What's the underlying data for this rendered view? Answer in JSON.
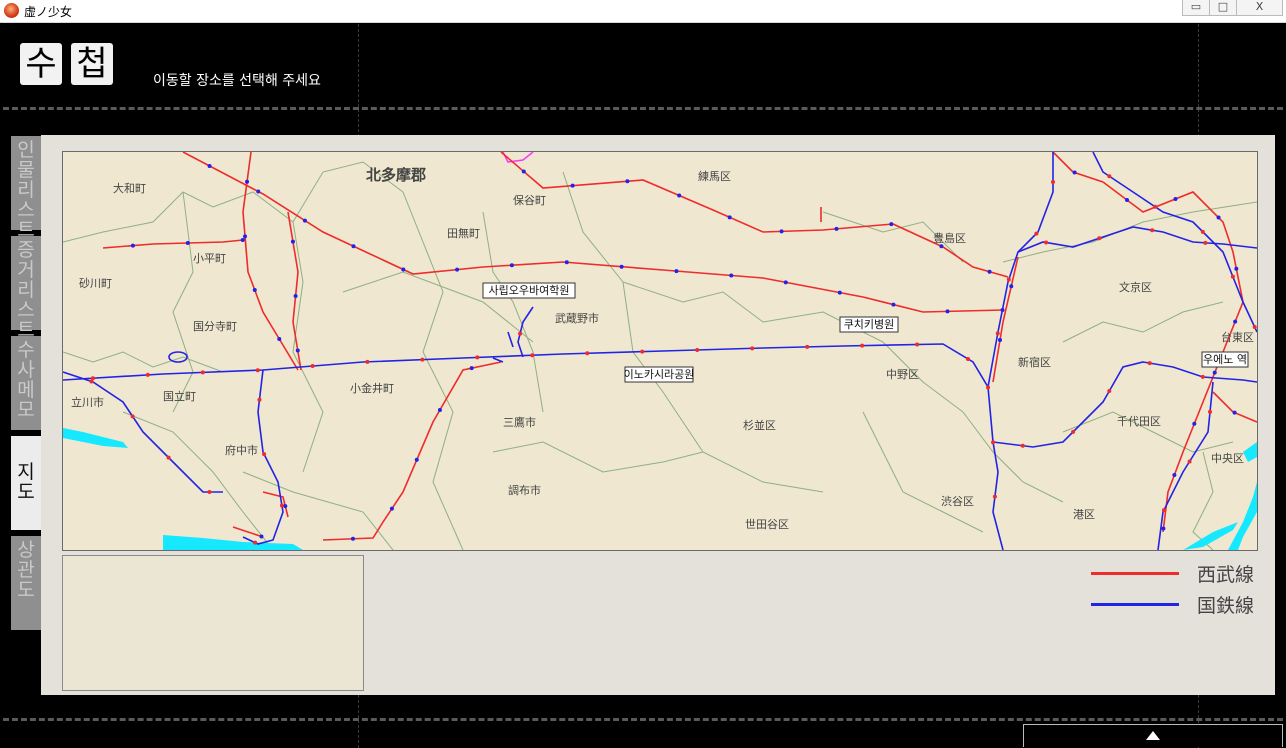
{
  "window": {
    "title": "虚ノ少女",
    "minimize_glyph": "▭",
    "maximize_glyph": "□",
    "close_glyph": "X"
  },
  "header": {
    "logo_chars": [
      "수",
      "첩"
    ],
    "instruction": "이동할 장소를 선택해 주세요"
  },
  "tabs": [
    {
      "label": "인물리스트",
      "active": false
    },
    {
      "label": "증거리스트",
      "active": false
    },
    {
      "label": "수사메모",
      "active": false
    },
    {
      "label": "지도",
      "active": true
    },
    {
      "label": "상관도",
      "active": false
    }
  ],
  "map": {
    "colors": {
      "background": "#efe7d0",
      "boundary": "#8fb083",
      "water": "#16e8ff",
      "seibu": "#ef2b2b",
      "jr": "#2323e6"
    },
    "district_labels": [
      {
        "text": "北多摩郡"
      },
      {
        "text": "大和町"
      },
      {
        "text": "小平町"
      },
      {
        "text": "砂川町"
      },
      {
        "text": "国分寺町"
      },
      {
        "text": "立川市"
      },
      {
        "text": "国立町"
      },
      {
        "text": "府中市"
      },
      {
        "text": "小金井町"
      },
      {
        "text": "保谷町"
      },
      {
        "text": "田無町"
      },
      {
        "text": "武蔵野市"
      },
      {
        "text": "三鷹市"
      },
      {
        "text": "調布市"
      },
      {
        "text": "練馬区"
      },
      {
        "text": "杉並区"
      },
      {
        "text": "世田谷区"
      },
      {
        "text": "豊島区"
      },
      {
        "text": "中野区"
      },
      {
        "text": "渋谷区"
      },
      {
        "text": "新宿区"
      },
      {
        "text": "文京区"
      },
      {
        "text": "千代田区"
      },
      {
        "text": "港区"
      },
      {
        "text": "台東区"
      },
      {
        "text": "中央区"
      }
    ],
    "locations": [
      {
        "label": "사립오우바여학원"
      },
      {
        "label": "쿠치키병원"
      },
      {
        "label": "이노카시라공원"
      },
      {
        "label": "우에노 역"
      }
    ]
  },
  "legend": [
    {
      "label": "西武線",
      "color": "#ef2b2b"
    },
    {
      "label": "国鉄線",
      "color": "#2323e6"
    }
  ],
  "footer": {
    "arrow_glyph": "▲"
  }
}
